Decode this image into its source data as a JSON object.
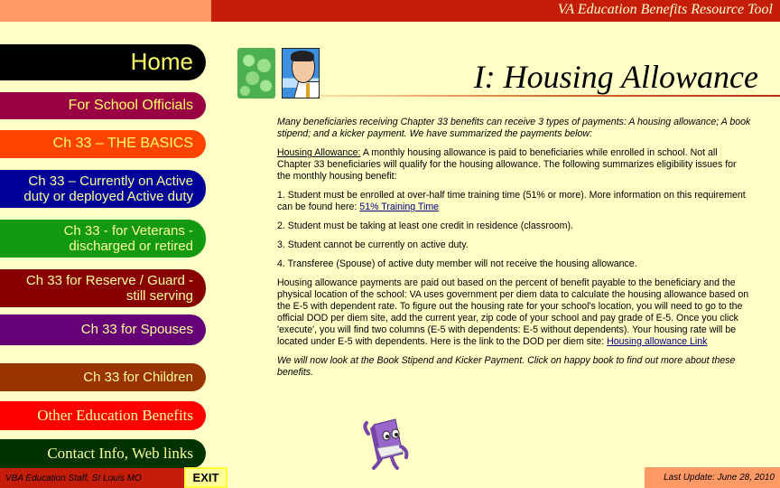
{
  "header": {
    "app_title": "VA Education Benefits Resource Tool"
  },
  "nav": {
    "home": "Home",
    "school_officials": "For School Officials",
    "basics": "Ch 33 – THE BASICS",
    "active_duty": "Ch 33 – Currently on Active duty or deployed Active duty",
    "veterans": "Ch 33 - for Veterans - discharged or retired",
    "reserve": "Ch 33 for Reserve / Guard - still serving",
    "spouses": "Ch 33 for Spouses",
    "children": "Ch 33 for Children",
    "other": "Other Education Benefits",
    "contact": "Contact Info, Web links"
  },
  "footer": {
    "staff": "VBA Education Staff, St Louis MO",
    "exit": "EXIT",
    "last_update": "Last Update:  June 28, 2010"
  },
  "images": {
    "money": "money-pills-image",
    "man": "businessman-image",
    "book": "happy-book-image"
  },
  "main": {
    "title": "I: Housing Allowance",
    "intro": "Many beneficiaries receiving Chapter 33 benefits can receive 3 types of payments:  A housing allowance; A book stipend; and a kicker payment.  We have summarized the payments below:",
    "housing_label": "Housing Allowance:",
    "housing_text": "  A monthly housing allowance is paid to beneficiaries while enrolled in school. Not all Chapter 33 beneficiaries will qualify for the housing allowance.  The following summarizes eligibility issues for the monthly housing benefit:",
    "item1": "1.  Student must be enrolled at over-half time training time (51% or more).  More information on this requirement can be found here:  ",
    "item1_link": "51% Training Time",
    "item2": "2.  Student must be taking at least one credit in residence (classroom).",
    "item3": "3.  Student cannot be currently on active duty.",
    "item4": "4.  Transferee (Spouse) of active duty member will not receive the housing allowance.",
    "payments_text": "Housing allowance payments are paid out based on the percent of benefit payable to the beneficiary and the physical location of the school:   VA uses government per diem data to calculate the housing allowance based on the E-5 with dependent rate.  To figure out the housing rate for your school's location, you will need to go to the official DOD per diem site, add the current year, zip code of your school and pay grade of E-5.  Once you click 'execute', you will find two columns (E-5 with dependents:  E-5 without dependents).  Your housing rate will be located under E-5 with dependents.  Here is the link to the DOD per diem site:  ",
    "payments_link": "Housing allowance Link",
    "closing": "We will now look at the Book Stipend and Kicker Payment.  Click on happy book to find out more about these benefits."
  }
}
